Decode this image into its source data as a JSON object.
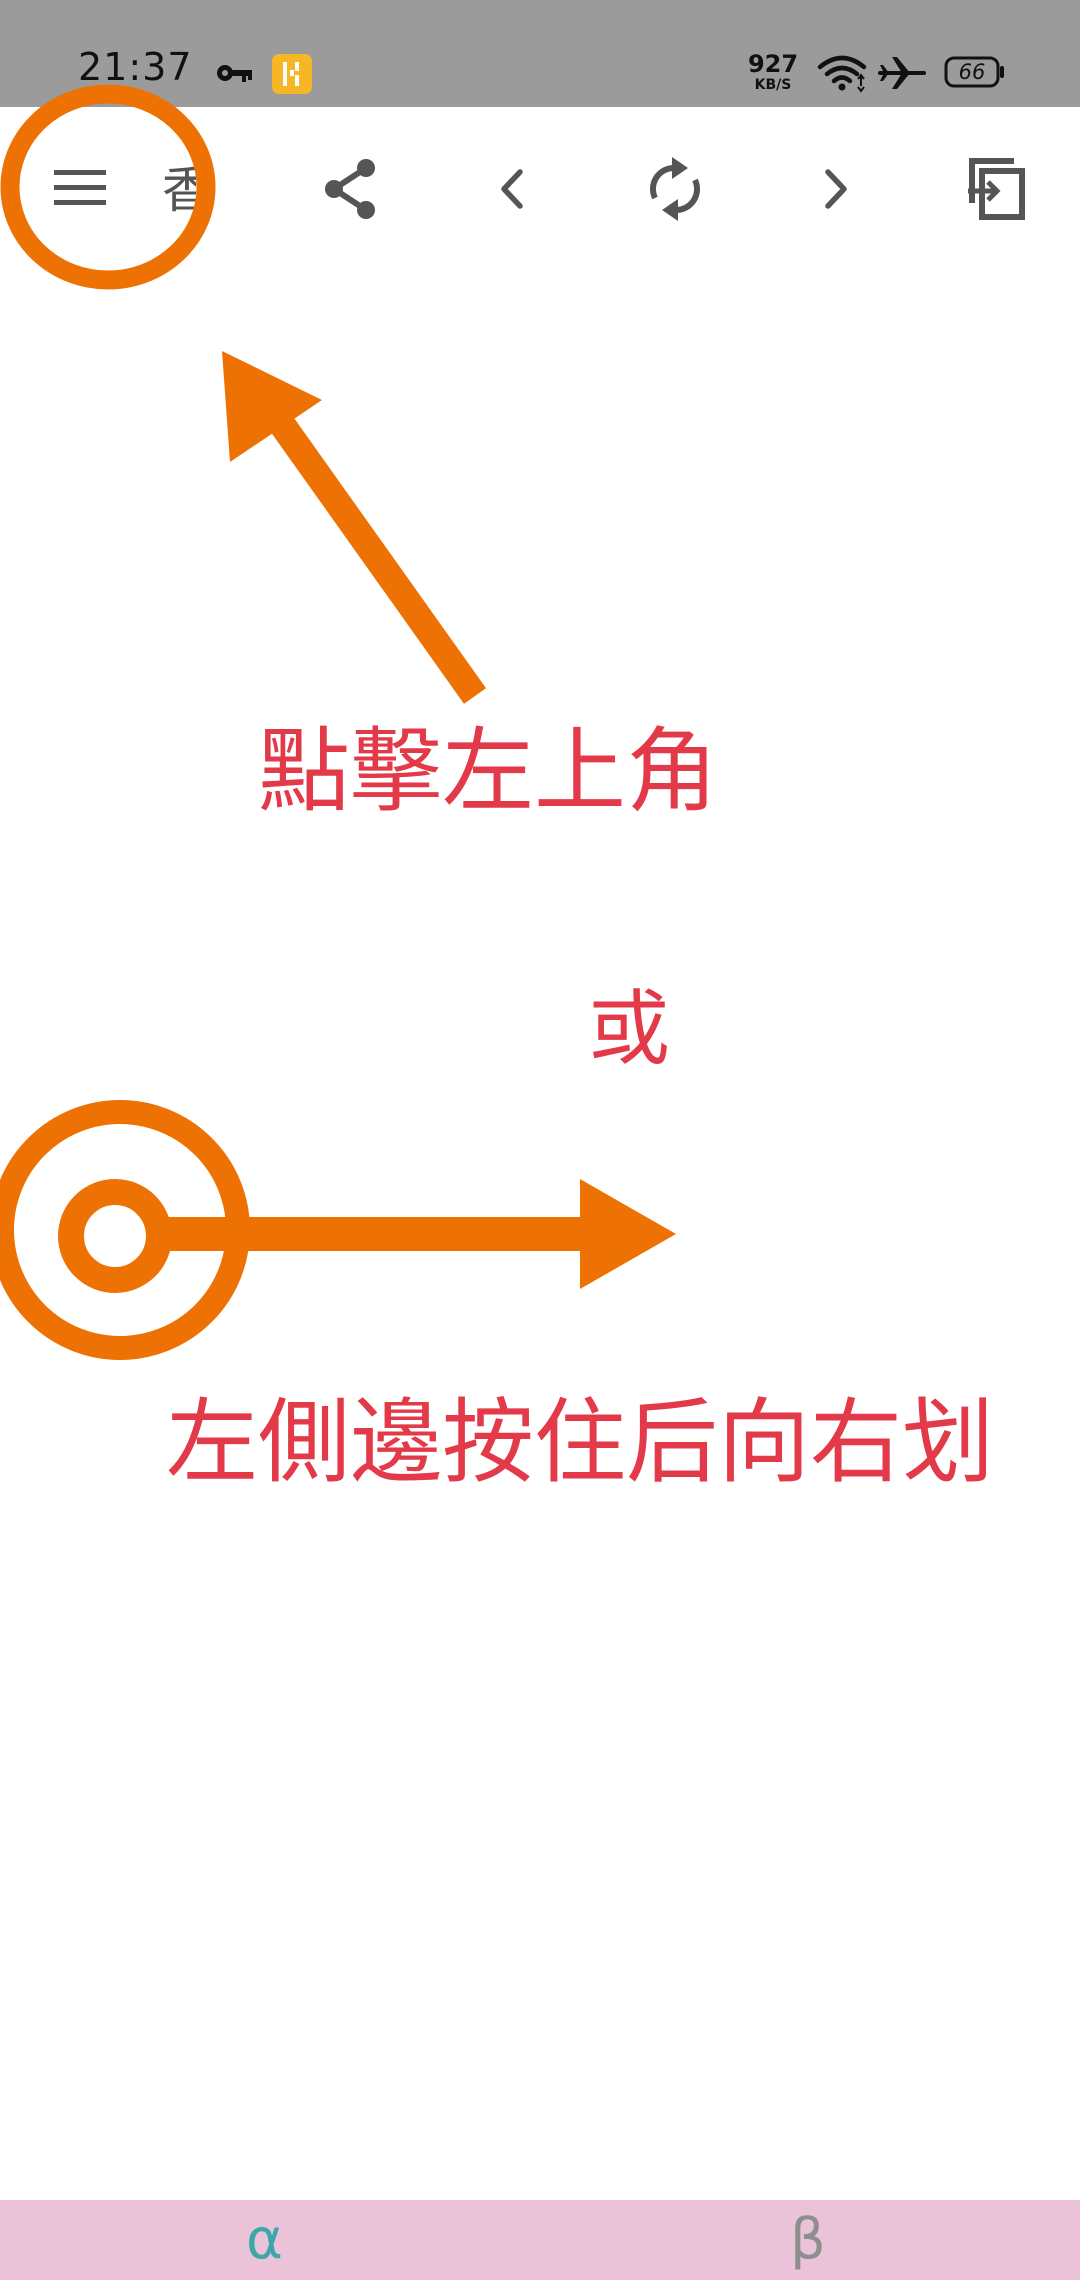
{
  "status_bar": {
    "time": "21:37",
    "key_icon": "key-icon",
    "app_badge_icon": "app-badge-icon",
    "net_speed_value": "927",
    "net_speed_unit": "KB/S",
    "wifi_icon": "wifi-icon",
    "airplane_icon": "airplane-mode-icon",
    "battery_level": "66"
  },
  "toolbar": {
    "menu_icon": "hamburger-menu-icon",
    "partial_title": "香",
    "share_icon": "share-icon",
    "back_icon": "chevron-left-icon",
    "refresh_icon": "refresh-icon",
    "forward_icon": "chevron-right-icon",
    "exit_icon": "exit-window-icon"
  },
  "annotations": {
    "tap_top_left": "點擊左上角",
    "or": "或",
    "swipe_from_left": "左側邊按住后向右划"
  },
  "bottom_tabs": [
    {
      "label": "α"
    },
    {
      "label": "β"
    }
  ],
  "colors": {
    "status_bar_bg": "#9b9b9b",
    "annotation_orange": "#ee7203",
    "annotation_text_red": "#e33a4a",
    "bottom_bar_bg": "#eac3d8",
    "tab_alpha_color": "#3aa8a8",
    "tab_beta_color": "#8e8e8e",
    "icon_gray": "#555555"
  }
}
